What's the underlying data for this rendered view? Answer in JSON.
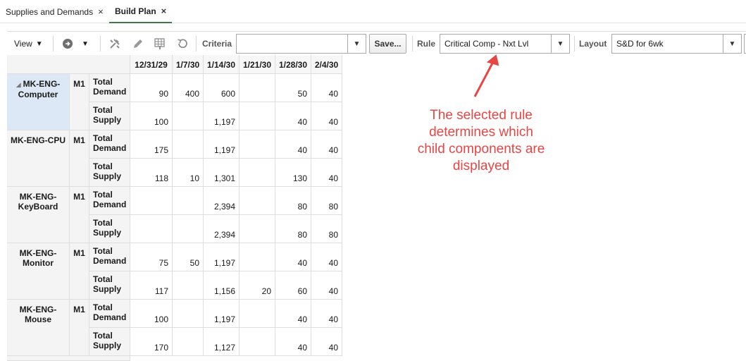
{
  "tabs": [
    {
      "label": "Supplies and Demands",
      "close": "×"
    },
    {
      "label": "Build Plan",
      "close": "×"
    }
  ],
  "toolbar": {
    "view_label": "View",
    "criteria_label": "Criteria",
    "criteria_value": "",
    "save_label": "Save...",
    "rule_label": "Rule",
    "rule_value": "Critical Comp - Nxt Lvl",
    "layout_label": "Layout",
    "layout_value": "S&D for 6wk",
    "icons": [
      "go-icon",
      "tools-icon",
      "edit-icon",
      "grid-edit-icon",
      "refresh-icon"
    ]
  },
  "table": {
    "dates": [
      "12/31/29",
      "1/7/30",
      "1/14/30",
      "1/21/30",
      "1/28/30",
      "2/4/30"
    ],
    "groups": [
      {
        "item": "MK-ENG-Computer",
        "org": "M1",
        "selected": true,
        "rows": [
          {
            "measure": "Total Demand",
            "values": [
              "90",
              "400",
              "600",
              "",
              "50",
              "40"
            ]
          },
          {
            "measure": "Total Supply",
            "values": [
              "100",
              "",
              "1,197",
              "",
              "40",
              "40"
            ]
          }
        ]
      },
      {
        "item": "MK-ENG-CPU",
        "org": "M1",
        "rows": [
          {
            "measure": "Total Demand",
            "values": [
              "175",
              "",
              "1,197",
              "",
              "40",
              "40"
            ]
          },
          {
            "measure": "Total Supply",
            "values": [
              "118",
              "10",
              "1,301",
              "",
              "130",
              "40"
            ]
          }
        ]
      },
      {
        "item": "MK-ENG-KeyBoard",
        "org": "M1",
        "rows": [
          {
            "measure": "Total Demand",
            "values": [
              "",
              "",
              "2,394",
              "",
              "80",
              "80"
            ]
          },
          {
            "measure": "Total Supply",
            "values": [
              "",
              "",
              "2,394",
              "",
              "80",
              "80"
            ]
          }
        ]
      },
      {
        "item": "MK-ENG-Monitor",
        "org": "M1",
        "rows": [
          {
            "measure": "Total Demand",
            "values": [
              "75",
              "50",
              "1,197",
              "",
              "40",
              "40"
            ]
          },
          {
            "measure": "Total Supply",
            "values": [
              "117",
              "",
              "1,156",
              "20",
              "60",
              "40"
            ]
          }
        ]
      },
      {
        "item": "MK-ENG-Mouse",
        "org": "M1",
        "rows": [
          {
            "measure": "Total Demand",
            "values": [
              "100",
              "",
              "1,197",
              "",
              "40",
              "40"
            ]
          },
          {
            "measure": "Total Supply",
            "values": [
              "170",
              "",
              "1,127",
              "",
              "40",
              "40"
            ]
          }
        ]
      }
    ]
  },
  "annotation": {
    "lines": [
      "The selected rule",
      "determines which",
      "child components are",
      "displayed"
    ],
    "color": "#e84545"
  },
  "colors": {
    "accent_tab": "#3e7d4a",
    "selected_row": "#dce8f5"
  }
}
